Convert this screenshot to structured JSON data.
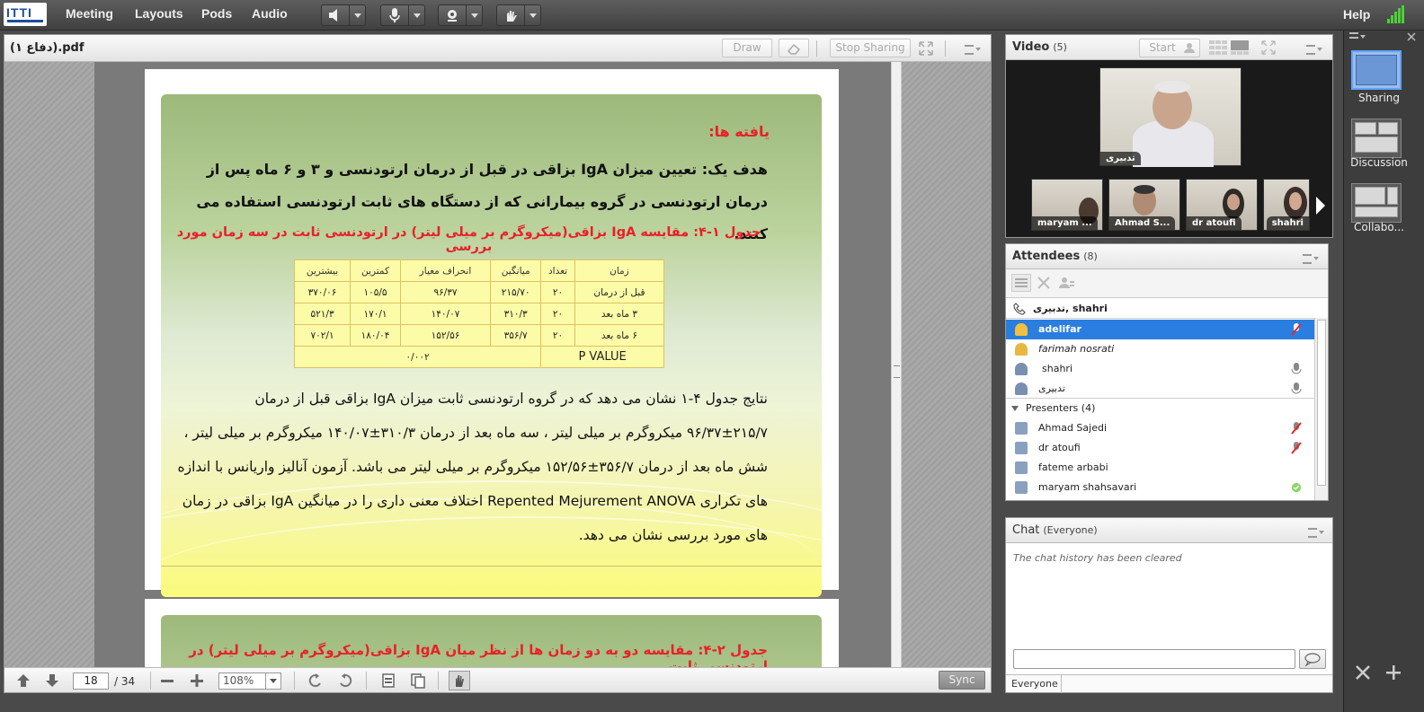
{
  "topbar": {
    "logo": "ITTI",
    "menus": [
      "Meeting",
      "Layouts",
      "Pods",
      "Audio"
    ],
    "help": "Help"
  },
  "share": {
    "doc_title": "(دفاع ۱).pdf",
    "draw": "Draw",
    "stop_sharing": "Stop Sharing",
    "slide1": {
      "findings_title": "یافته ها:",
      "goal": "هدف یک: تعیین میزان IgA بزاقی در قبل از درمان ارتودنسی و ۳ و ۶ ماه پس از درمان ارتودنسی در گروه بیمارانی که از دستگاه های ثابت ارتودنسی استفاده می کنند.",
      "table_caption": "جدول ۱-۴: مقایسه IgA بزاقی(میکروگرم بر میلی لیتر) در ارتودنسی ثابت در سه زمان مورد بررسی",
      "table": {
        "headers": [
          "زمان",
          "تعداد",
          "میانگین",
          "انحراف معیار",
          "کمترین",
          "بیشترین"
        ],
        "rows": [
          [
            "قبل از درمان",
            "۲۰",
            "۲۱۵/۷۰",
            "۹۶/۳۷",
            "۱۰۵/۵",
            "۳۷۰/۰۶"
          ],
          [
            "۳ ماه بعد",
            "۲۰",
            "۳۱۰/۳",
            "۱۴۰/۰۷",
            "۱۷۰/۱",
            "۵۲۱/۳"
          ],
          [
            "۶ ماه بعد",
            "۲۰",
            "۳۵۶/۷",
            "۱۵۲/۵۶",
            "۱۸۰/۰۴",
            "۷۰۲/۱"
          ]
        ],
        "pvalue_label": "P VALUE",
        "pvalue": "۰/۰۰۲"
      },
      "results": "نتایج جدول ۴-۱ نشان می دهد که در گروه ارتودنسی ثابت میزان IgA بزاقی قبل از درمان ۲۱۵/۷±۹۶/۳۷ میکروگرم بر میلی لیتر ، سه ماه بعد از درمان ۳۱۰/۳±۱۴۰/۰۷ میکروگرم بر میلی لیتر ، شش ماه بعد از درمان ۳۵۶/۷±۱۵۲/۵۶ میکروگرم بر میلی لیتر می باشد. آزمون آنالیز واریانس با اندازه های تکراری Repented Mejurement ANOVA اختلاف معنی داری را در میانگین IgA بزاقی در زمان های مورد بررسی نشان می دهد."
    },
    "slide2": {
      "caption": "جدول ۲-۴: مقایسه دو به دو زمان ها از نظر میان IgA بزاقی(میکروگرم بر میلی لیتر) در ارتودنسی ثابت"
    },
    "footer": {
      "page": "18",
      "total": "/ 34",
      "zoom": "108%",
      "sync": "Sync"
    }
  },
  "video": {
    "title": "Video",
    "count": "(5)",
    "start": "Start",
    "main_label": "تدبیری",
    "thumbs": [
      "maryam ...",
      "Ahmad S...",
      "dr atoufi",
      "shahri"
    ]
  },
  "attendees": {
    "title": "Attendees",
    "count": "(8)",
    "speaking": "تدبیری, shahri",
    "participants": [
      "adelifar",
      "farimah nosrati",
      "shahri",
      "تدبیری"
    ],
    "presenters_header": "Presenters (4)",
    "presenters": [
      "Ahmad Sajedi",
      "dr atoufi",
      "fateme arbabi",
      "maryam shahsavari"
    ]
  },
  "chat": {
    "title": "Chat",
    "audience": "(Everyone)",
    "history": "The chat history has been cleared",
    "target": "Everyone"
  },
  "layouts": [
    "Sharing",
    "Discussion",
    "Collabo..."
  ],
  "colors": {
    "accent_blue": "#2a7ee0",
    "slide_red": "#e8202a",
    "table_bg": "#fcfca8"
  }
}
